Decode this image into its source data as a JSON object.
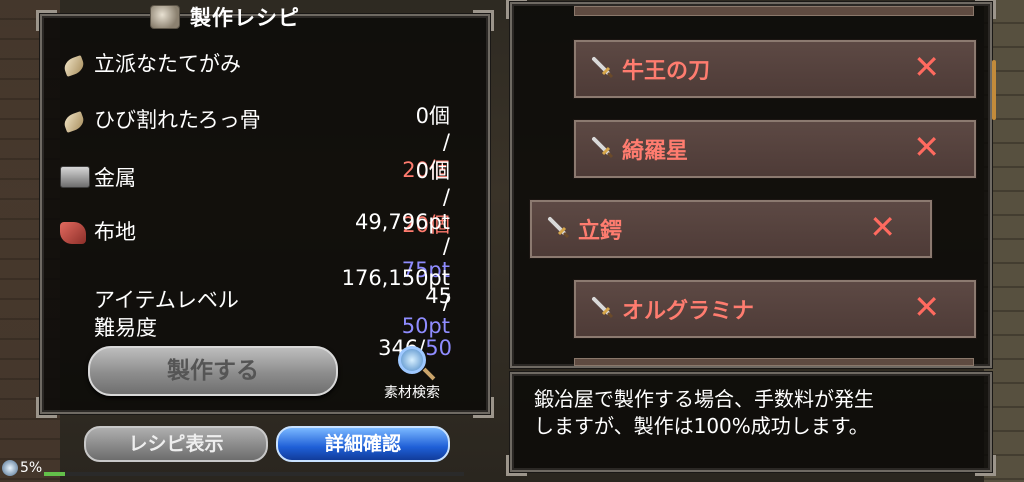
{
  "left_panel": {
    "title": "製作レシピ",
    "materials": [
      {
        "name": "立派なたてがみ",
        "icon": "horn-icon",
        "have": "0個",
        "need": "20個"
      },
      {
        "name": "ひび割れたろっ骨",
        "icon": "horn-icon",
        "have": "0個",
        "need": "20個"
      },
      {
        "name": "金属",
        "icon": "metal-ingot-icon",
        "have": "49,796pt",
        "need": "75pt"
      },
      {
        "name": "布地",
        "icon": "cloth-icon",
        "have": "176,150pt",
        "need": "50pt"
      }
    ],
    "slash": "/",
    "item_level_label": "アイテムレベル",
    "item_level_value": "45",
    "difficulty_label": "難易度",
    "difficulty_value": "346/",
    "difficulty_max": "50",
    "craft_button": "製作する",
    "search_label": "素材検索"
  },
  "bottom_buttons": {
    "recipe": "レシピ表示",
    "detail": "詳細確認"
  },
  "footer": {
    "percent": "5%",
    "progress": 0.05
  },
  "recipe_list": [
    {
      "name": "牛王の刀",
      "icon": "sword-icon",
      "mark": "✕"
    },
    {
      "name": "綺羅星",
      "icon": "sword-icon",
      "mark": "✕"
    },
    {
      "name": "立鍔",
      "icon": "sword-icon",
      "mark": "✕"
    },
    {
      "name": "オルグラミナ",
      "icon": "sword-icon",
      "mark": "✕"
    }
  ],
  "message": {
    "line1": "鍛冶屋で製作する場合、手数料が発生",
    "line2": "しますが、製作は100%成功します。"
  },
  "colors": {
    "need_red": "#ff7b6e",
    "need_blue": "#8f8cff",
    "recipe_name": "#ff7c6f",
    "detail_button": "#1f5fd7"
  }
}
